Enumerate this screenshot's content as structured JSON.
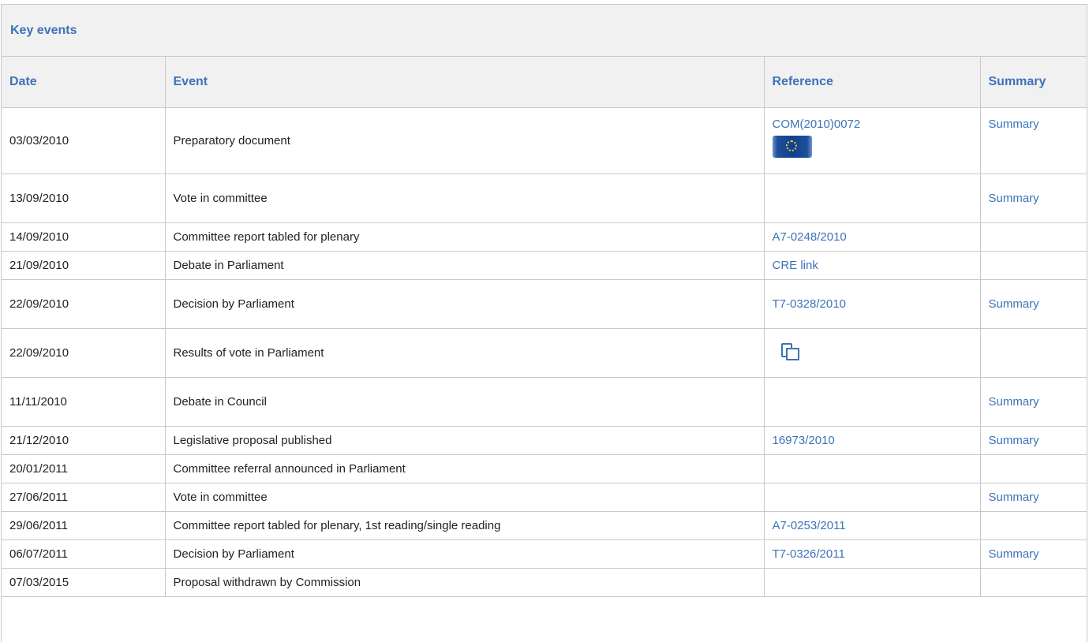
{
  "section_title": "Key events",
  "columns": {
    "date": "Date",
    "event": "Event",
    "reference": "Reference",
    "summary": "Summary"
  },
  "rows": [
    {
      "date": "03/03/2010",
      "event": "Preparatory document",
      "reference": "COM(2010)0072",
      "ref_icon": "eu-flag-icon",
      "summary": "Summary"
    },
    {
      "date": "13/09/2010",
      "event": "Vote in committee",
      "reference": "",
      "summary": "Summary"
    },
    {
      "date": "14/09/2010",
      "event": "Committee report tabled for plenary",
      "reference": "A7-0248/2010",
      "summary": ""
    },
    {
      "date": "21/09/2010",
      "event": "Debate in Parliament",
      "reference": "CRE link",
      "summary": ""
    },
    {
      "date": "22/09/2010",
      "event": "Decision by Parliament",
      "reference": "T7-0328/2010",
      "summary": "Summary"
    },
    {
      "date": "22/09/2010",
      "event": "Results of vote in Parliament",
      "reference": "",
      "ref_icon": "vote-results-icon",
      "summary": ""
    },
    {
      "date": "11/11/2010",
      "event": "Debate in Council",
      "reference": "",
      "summary": "Summary"
    },
    {
      "date": "21/12/2010",
      "event": "Legislative proposal published",
      "reference": "16973/2010",
      "summary": "Summary"
    },
    {
      "date": "20/01/2011",
      "event": "Committee referral announced in Parliament",
      "reference": "",
      "summary": ""
    },
    {
      "date": "27/06/2011",
      "event": "Vote in committee",
      "reference": "",
      "summary": "Summary"
    },
    {
      "date": "29/06/2011",
      "event": "Committee report tabled for plenary, 1st reading/single reading",
      "reference": "A7-0253/2011",
      "summary": ""
    },
    {
      "date": "06/07/2011",
      "event": "Decision by Parliament",
      "reference": "T7-0326/2011",
      "summary": "Summary"
    },
    {
      "date": "07/03/2015",
      "event": "Proposal withdrawn by Commission",
      "reference": "",
      "summary": ""
    }
  ]
}
